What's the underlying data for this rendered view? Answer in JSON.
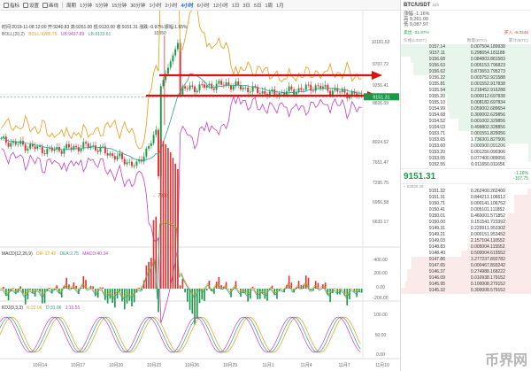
{
  "toolbar": {
    "items": [
      "指标",
      "设置",
      "画线",
      "周期",
      "1分钟",
      "5分钟",
      "15分钟",
      "30分钟",
      "1小时",
      "2小时",
      "4小时",
      "6小时",
      "12小时",
      "1日",
      "3日",
      "5日",
      "1周",
      "1月"
    ],
    "active": "4小时"
  },
  "legends": {
    "main": "时间:2019-11-08 12:00 开:9240.83 高:9261.00 低:9120.00 收:9151.31 涨跌:-0.97% 振幅:1.55%",
    "boll": "BOLL(20,2)",
    "boll_vals": [
      "BOLL:9285.75",
      "UB:9437.89",
      "LB:9133.61"
    ],
    "macd": "MACD(12,26,9)",
    "macd_vals": [
      "DIF:17.42",
      "DEA:2.75",
      "MACD:40.34"
    ],
    "kdj": "KDJ(9,3,3)",
    "kdj_vals": [
      "K:22.06",
      "D:31.06",
      "J:15.55"
    ]
  },
  "axis": {
    "price_ticks": [
      "10181.53",
      "9707.72",
      "9256.41",
      "8826.09",
      "8024.52",
      "7651.47",
      "7295.75",
      "6956.58",
      "6633.17"
    ],
    "high_label": "10350",
    "low_label": "7300",
    "current_price": "9151.31",
    "macd_ticks": [
      "400.00",
      "200.00",
      "0.00",
      "-200.00"
    ],
    "kdj_ticks": [
      "100.00",
      "50.00",
      "0.00"
    ],
    "date_ticks": [
      "10月14",
      "10月17",
      "10月20",
      "10月23",
      "10月26",
      "10月29",
      "11月1",
      "11月4",
      "11月7",
      "11月10"
    ]
  },
  "chart_data": {
    "type": "candlestick",
    "interval": "4小时",
    "x": [
      "10月14",
      "10月17",
      "10月20",
      "10月23",
      "10月26",
      "10月29",
      "11月1",
      "11月4",
      "11月7",
      "11月10"
    ],
    "close_estimates": [
      8300,
      8100,
      8200,
      7800,
      9300,
      9400,
      9200,
      9350,
      9151.31
    ],
    "annotated_high": 10350,
    "annotated_low": 7300,
    "last": 9151.31
  },
  "panel": {
    "symbol": "BTC/USDT",
    "sub": "24h",
    "stats": [
      "涨幅 -1.16%",
      "高 9,261.00",
      "低 9,087.97"
    ],
    "tabs": [
      "卖出 -31.97%",
      "买入 -9.3246"
    ],
    "col_headers": [
      "价格(USDT)",
      "数量(BTC)",
      "累计(BTC)"
    ],
    "asks": [
      [
        "9157.14",
        "0.00750",
        "4.189938"
      ],
      [
        "9157.11",
        "0.29865",
        "4.181188"
      ],
      [
        "9156.68",
        "0.08480",
        "3.881583"
      ],
      [
        "9156.63",
        "0.00515",
        "3.796823"
      ],
      [
        "9156.62",
        "0.87365",
        "3.795273"
      ],
      [
        "9156.22",
        "0.00375",
        "2.921588"
      ],
      [
        "9155.81",
        "0.00155",
        "2.917838"
      ],
      [
        "9155.54",
        "0.21845",
        "2.916288"
      ],
      [
        "9155.20",
        "0.00001",
        "2.697838"
      ],
      [
        "9155.10",
        "0.00818",
        "2.697834"
      ],
      [
        "9154.99",
        "0.05900",
        "2.689654"
      ],
      [
        "9154.68",
        "0.30000",
        "2.629856"
      ],
      [
        "9154.52",
        "0.00100",
        "2.329856"
      ],
      [
        "9154.03",
        "0.49980",
        "2.328856"
      ],
      [
        "9153.71",
        "0.00155",
        "1.829056"
      ],
      [
        "9153.65",
        "1.73630",
        "1.827506"
      ],
      [
        "9153.60",
        "0.00090",
        "0.091206"
      ],
      [
        "9153.20",
        "0.00125",
        "0.090306"
      ],
      [
        "9153.05",
        "0.07740",
        "0.089056"
      ],
      [
        "9152.55",
        "0.01165",
        "0.011656"
      ]
    ],
    "last": "9151.31",
    "last_change": "-1.16%",
    "last_abs": "-107.75",
    "last_cny": "≈ 63830.39",
    "bids": [
      [
        "9151.32",
        "0.26240",
        "0.262400"
      ],
      [
        "9151.31",
        "0.84421",
        "1.106612"
      ],
      [
        "9150.71",
        "0.00014",
        "1.106752"
      ],
      [
        "9150.41",
        "0.00510",
        "1.111852"
      ],
      [
        "9150.01",
        "0.46000",
        "1.571852"
      ],
      [
        "9150.00",
        "0.15154",
        "1.723392"
      ],
      [
        "9149.31",
        "0.22991",
        "1.953302"
      ],
      [
        "9149.21",
        "0.00015",
        "1.953452"
      ],
      [
        "9149.03",
        "2.15710",
        "4.110552"
      ],
      [
        "9148.83",
        "0.00500",
        "4.115552"
      ],
      [
        "9148.40",
        "0.50000",
        "4.615552"
      ],
      [
        "9147.86",
        "3.27723",
        "7.892782"
      ],
      [
        "9147.65",
        "0.00046",
        "7.893242"
      ],
      [
        "9146.37",
        "0.27498",
        "8.168222"
      ],
      [
        "9146.09",
        "0.01093",
        "8.179152"
      ],
      [
        "9145.95",
        "0.10000",
        "8.279152"
      ],
      [
        "9145.32",
        "0.30000",
        "8.579152"
      ]
    ]
  },
  "watermark": "币界网"
}
